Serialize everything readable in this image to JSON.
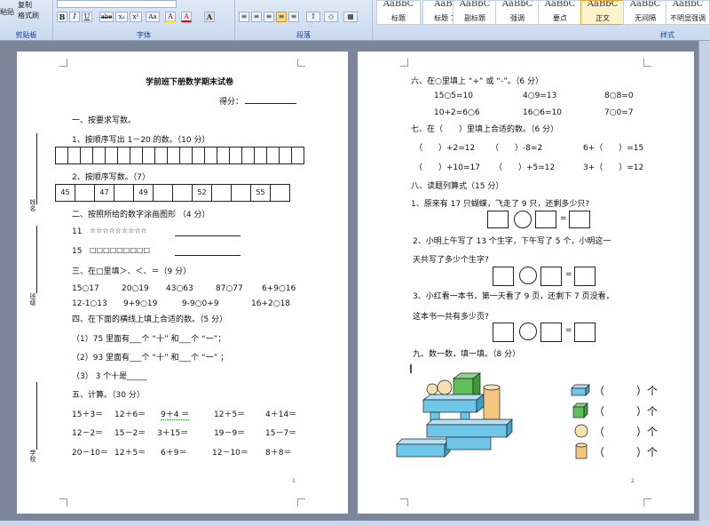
{
  "ribbon": {
    "clipboard": {
      "copy": "复制",
      "format_painter": "格式刷",
      "paste": "粘贴",
      "label": "剪贴板"
    },
    "font": {
      "label": "字体",
      "bold": "B",
      "italic": "I",
      "underline": "U",
      "strike": "abe",
      "sub": "x₂",
      "sup": "x²",
      "case": "Aa",
      "color": "A",
      "highlight": "A"
    },
    "paragraph": {
      "label": "段落"
    },
    "styles": {
      "label": "样式",
      "items": [
        {
          "preview": "AaBbC",
          "name": "标题"
        },
        {
          "preview": "AaBl",
          "name": "标题 1"
        },
        {
          "preview": "AaBbC",
          "name": "副标题"
        },
        {
          "preview": "AaBbC",
          "name": "强调"
        },
        {
          "preview": "AaBbC",
          "name": "要点"
        },
        {
          "preview": "AaBbC",
          "name": "正文"
        },
        {
          "preview": "AaBbC",
          "name": "无间隔"
        },
        {
          "preview": "AaBbC",
          "name": "不明显强调"
        }
      ]
    }
  },
  "page1": {
    "title": "学前班下册数学期末试卷",
    "score_label": "得分：",
    "s1": "一、按要求写数。",
    "s1_q1": "1、按顺序写出 1－20 的数。（10 分）",
    "s1_q2": "2、按顺序写数。（7）",
    "row2": [
      "45",
      "",
      "47",
      "",
      "49",
      "",
      "",
      "52",
      "",
      "",
      "55",
      ""
    ],
    "s2": "二、按照所给的数字涂画图形 （4 分）",
    "stars_num": "11",
    "stars": "☆☆☆☆☆☆☆☆☆",
    "squares_num": "15",
    "squares": "□□□□□□□□□",
    "s3": "三、在□里填＞、＜、＝（9 分）",
    "cmp_row1": [
      "15○17",
      "20○19",
      "43○63",
      "87○77",
      "6+9○16"
    ],
    "cmp_row2": [
      "12-1○13",
      "9+9○19",
      "9-9○0+9",
      "16+2○18"
    ],
    "s4": "四、在下面的横线上填上合适的数。（5 分）",
    "fill1": "（1）75 里面有___个 “十” 和___个 “一”；",
    "fill2": "（2）93 里面有___个 “十” 和___个 “一” ；",
    "fill3": "（3） 3 个十是_____",
    "s5": "五、计算。（30 分）",
    "calc_row1": [
      "15＋3＝",
      "12＋6＝",
      "9＋4 ＝",
      "12＋5＝",
      "4＋14＝"
    ],
    "calc_row2": [
      "12－2＝",
      "15－2＝",
      "3＋15＝",
      "19－9＝",
      "15－7＝"
    ],
    "calc_row3": [
      "20－10＝",
      "12＋5＝",
      "6＋9＝",
      "12－10＝",
      "8＋8＝"
    ],
    "side_name": "姓名",
    "side_class": "班级",
    "side_school": "学校",
    "page_num": "1"
  },
  "page2": {
    "s6": "六、在○里填上 “+” 或 “-”。（6 分）",
    "pm_row1": [
      "15○5=10",
      "4○9=13",
      "8○8=0"
    ],
    "pm_row2": [
      "10+2=6○6",
      "16○6=10",
      "7○0=7"
    ],
    "s7": "七、在（　　）里填上合适的数。（6 分）",
    "paren_row1": [
      "（　　）+2=12",
      "（　　）-8=2",
      "6+（　　）=15"
    ],
    "paren_row2": [
      "（　　）+10=17",
      "（　　）+5=12",
      "3+（　　）=12"
    ],
    "s8": "八、读题列算式（15 分）",
    "w1": "1、原来有 17 只蝴蝶，飞走了 9 只，还剩多少只?",
    "w2a": "2、小明上午写了 13 个生字，下午写了 5 个，小明这一",
    "w2b": "天共写了多少个生字?",
    "w3a": "3、小红看一本书，第一天看了 9 页，还剩下 7 页没看，",
    "w3b": "这本书一共有多少页?",
    "eq": "=",
    "s9": "九、数一数，填一填。（8 分）",
    "count_rows": [
      "（　　　）个",
      "（　　　）个",
      "（　　　）个",
      "（　　　）个"
    ],
    "page_num": "2"
  }
}
